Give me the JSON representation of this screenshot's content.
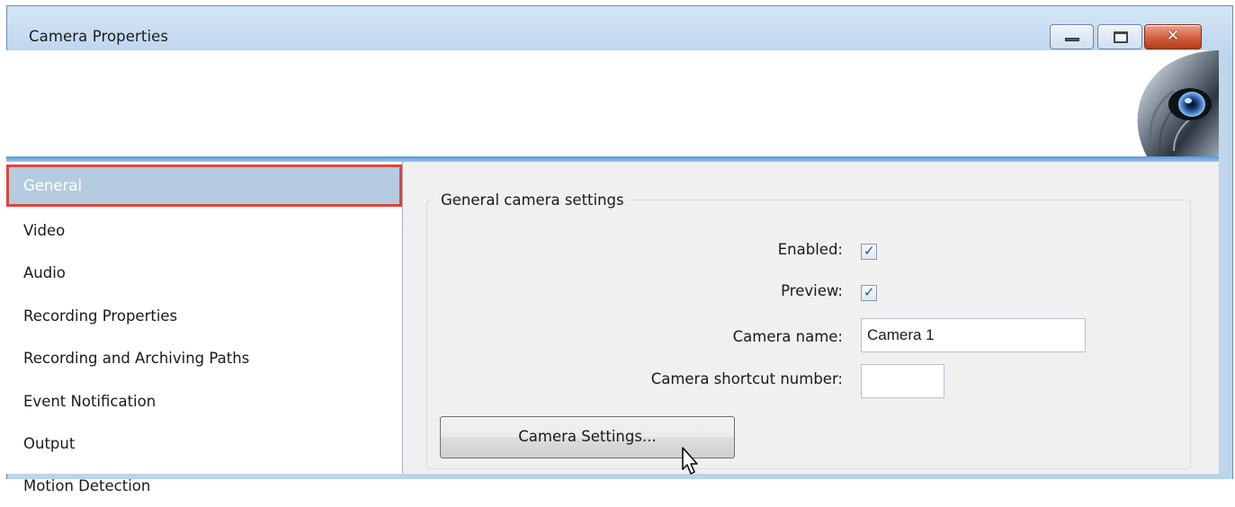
{
  "window": {
    "title": "Camera Properties",
    "controls": {
      "minimize": "minimize",
      "maximize": "maximize",
      "close": "✕"
    }
  },
  "sidebar": {
    "items": [
      {
        "label": "General",
        "selected": true
      },
      {
        "label": "Video"
      },
      {
        "label": "Audio"
      },
      {
        "label": "Recording Properties"
      },
      {
        "label": "Recording and Archiving Paths"
      },
      {
        "label": "Event Notification"
      },
      {
        "label": "Output"
      },
      {
        "label": "Motion Detection"
      }
    ]
  },
  "general": {
    "group_label": "General camera settings",
    "enabled_label": "Enabled:",
    "enabled_checked": true,
    "preview_label": "Preview:",
    "preview_checked": true,
    "camera_name_label": "Camera name:",
    "camera_name_value": "Camera 1",
    "shortcut_label": "Camera shortcut number:",
    "shortcut_value": "",
    "settings_button": "Camera Settings..."
  },
  "icons": {
    "logo": "wolf-eye-logo",
    "cursor": "mouse-pointer-icon",
    "check": "checkmark-icon"
  },
  "colors": {
    "titlebar": "#bdd5ee",
    "selection_highlight": "#b5cce0",
    "selection_outline": "#e0443a",
    "banner_strip": "#5b98d8",
    "close_button": "#d25d3c",
    "content_bg": "#f0f0f0"
  }
}
